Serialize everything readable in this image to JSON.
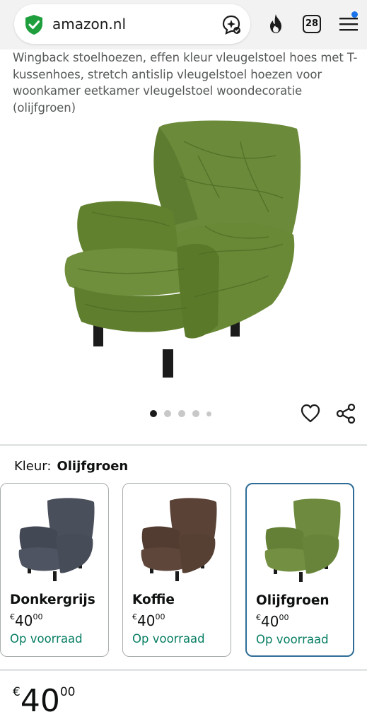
{
  "browser": {
    "url": "amazon.nl",
    "tab_count": "28"
  },
  "product": {
    "title": "Wingback stoelhoezen, effen kleur vleugelstoel hoes met T-kussenhoes, stretch antislip vleugelstoel hoezen voor woonkamer eetkamer vleugelstoel woondecoratie (olijfgroen)",
    "image_count": 5,
    "active_image_index": 0
  },
  "color_selector": {
    "label": "Kleur:",
    "selected": "Olijfgroen",
    "options": [
      {
        "name": "Donkergrijs",
        "currency": "€",
        "whole": "40",
        "fraction": "00",
        "stock": "Op voorraad",
        "color": "#4a4f5c"
      },
      {
        "name": "Koffie",
        "currency": "€",
        "whole": "40",
        "fraction": "00",
        "stock": "Op voorraad",
        "color": "#5a4236"
      },
      {
        "name": "Olijfgroen",
        "currency": "€",
        "whole": "40",
        "fraction": "00",
        "stock": "Op voorraad",
        "color": "#6e8a3e"
      }
    ]
  },
  "price": {
    "currency": "€",
    "whole": "40",
    "fraction": "00"
  },
  "colors": {
    "stock_green": "#067d62",
    "selected_border": "#2f6d97",
    "product_green": "#6b8a3a"
  }
}
